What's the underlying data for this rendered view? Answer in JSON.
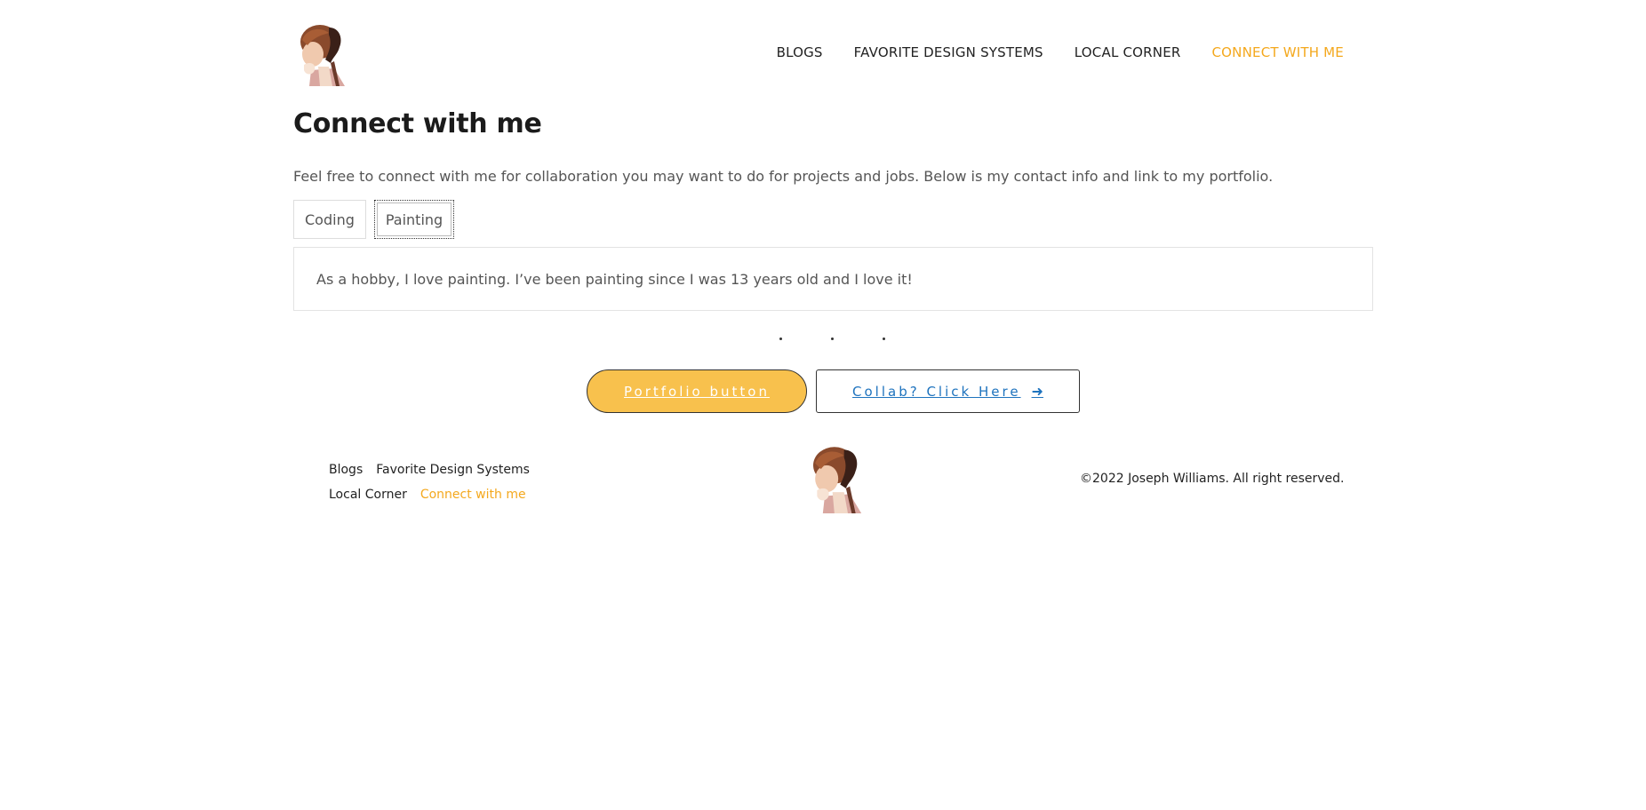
{
  "header": {
    "logo_icon": "woman-portrait-logo",
    "nav": [
      {
        "label": "BLOGS",
        "active": false
      },
      {
        "label": "FAVORITE DESIGN SYSTEMS",
        "active": false
      },
      {
        "label": "LOCAL CORNER",
        "active": false
      },
      {
        "label": "CONNECT WITH ME",
        "active": true
      }
    ]
  },
  "main": {
    "title": "Connect with me",
    "intro": "Feel free to connect with me for collaboration you may want to do for projects and jobs. Below is my contact info and link to my portfolio.",
    "tabs": [
      {
        "label": "Coding",
        "active": false
      },
      {
        "label": "Painting",
        "active": true
      }
    ],
    "panel_text": "As a hobby, I love painting. I’ve been painting since I was 13 years old and I love it!",
    "buttons": {
      "portfolio_label": "Portfolio button",
      "collab_label": "Collab? Click Here",
      "collab_icon": "arrow-right-icon"
    }
  },
  "footer": {
    "links": [
      {
        "label": "Blogs",
        "active": false
      },
      {
        "label": "Favorite Design Systems",
        "active": false
      },
      {
        "label": "Local Corner",
        "active": false
      },
      {
        "label": "Connect with me",
        "active": true
      }
    ],
    "logo_icon": "woman-portrait-logo",
    "copyright": "©2022 Joseph Williams. All right reserved."
  },
  "colors": {
    "accent": "#f4a81d",
    "button_fill": "#f8c14d",
    "link_blue": "#1e73be"
  }
}
